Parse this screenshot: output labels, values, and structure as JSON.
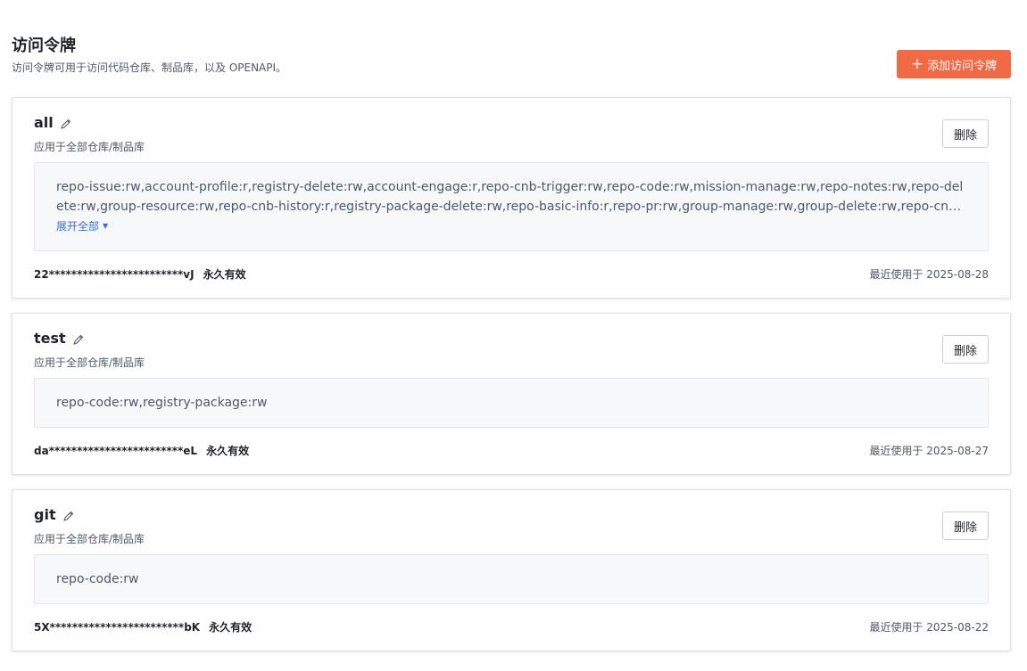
{
  "header": {
    "title": "访问令牌",
    "description": "访问令牌可用于访问代码仓库、制品库，以及 OPENAPI。",
    "add_button_label": "添加访问令牌",
    "accent_color": "#ef6a45"
  },
  "tokens": [
    {
      "name": "all",
      "scope_label": "应用于全部仓库/制品库",
      "permissions": "repo-issue:rw,account-profile:r,registry-delete:rw,account-engage:r,repo-cnb-trigger:rw,repo-code:rw,mission-manage:rw,repo-notes:rw,repo-delete:rw,group-resource:rw,repo-cnb-history:r,registry-package-delete:rw,repo-basic-info:r,repo-pr:rw,group-manage:rw,group-delete:rw,repo-cnb-detail:rw,regist",
      "expand_label": "展开全部",
      "delete_label": "删除",
      "masked_token": "22************************vJ",
      "validity": "永久有效",
      "last_used": "最近使用于 2025-08-28"
    },
    {
      "name": "test",
      "scope_label": "应用于全部仓库/制品库",
      "permissions": "repo-code:rw,registry-package:rw",
      "delete_label": "删除",
      "masked_token": "da************************eL",
      "validity": "永久有效",
      "last_used": "最近使用于 2025-08-27"
    },
    {
      "name": "git",
      "scope_label": "应用于全部仓库/制品库",
      "permissions": "repo-code:rw",
      "delete_label": "删除",
      "masked_token": "5X************************bK",
      "validity": "永久有效",
      "last_used": "最近使用于 2025-08-22"
    }
  ]
}
